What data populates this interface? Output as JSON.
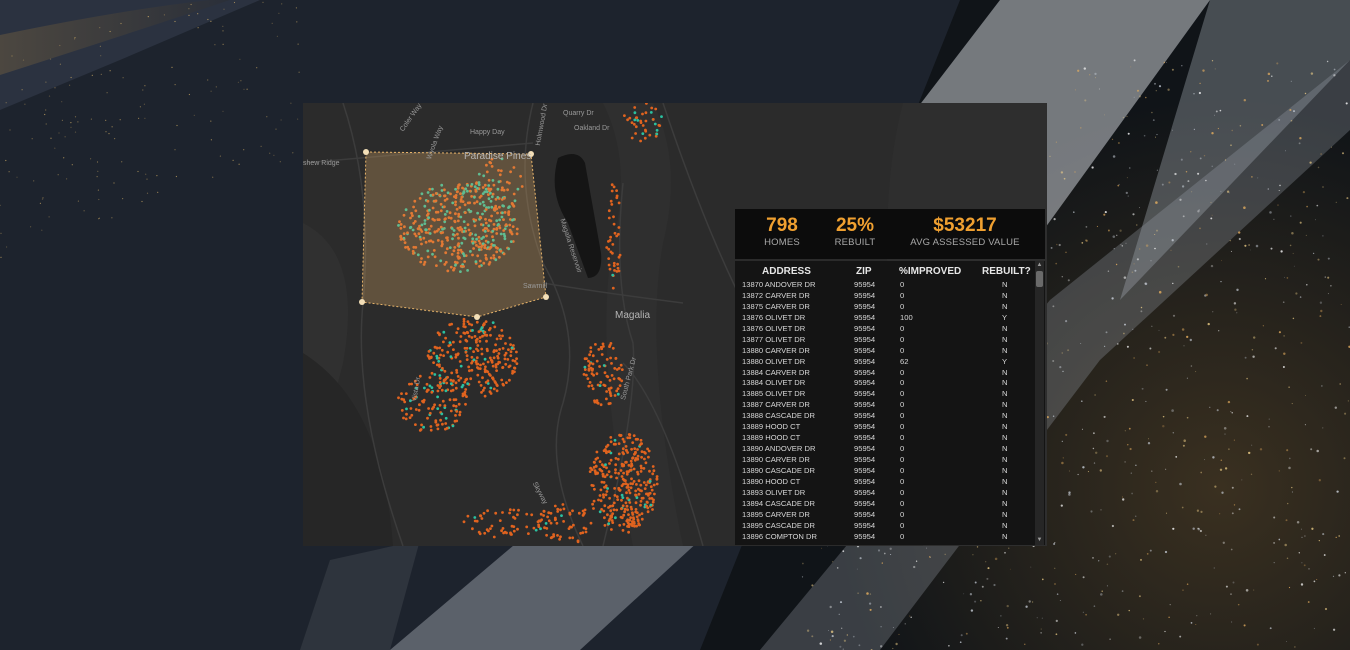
{
  "map": {
    "labels": {
      "quarry": "Quarry Dr",
      "oakland": "Oakland Dr",
      "happy_day": "Happy Day",
      "paradise_pines": "Paradise Pines",
      "ridge": "shew Ridge",
      "magalia": "Magalia",
      "reservoir": "Magalia Reservoir",
      "wyola": "Wyola Way",
      "coler": "Coler Way",
      "holmwood": "Holmwood Dr",
      "vista": "Vista Dr",
      "skyway": "Skyway",
      "south_park": "South Park Dr",
      "sawmill": "Sawmill"
    },
    "colors": {
      "not_rebuilt": "#e0631f",
      "rebuilt": "#2bc0a0",
      "selection": "#e8b46a"
    }
  },
  "stats": {
    "homes_value": "798",
    "homes_label": "HOMES",
    "rebuilt_value": "25%",
    "rebuilt_label": "REBUILT",
    "assessed_value": "$53217",
    "assessed_label": "AVG ASSESSED VALUE"
  },
  "table": {
    "headers": {
      "address": "ADDRESS",
      "zip": "ZIP",
      "improved": "%IMPROVED",
      "rebuilt": "REBUILT?"
    },
    "rows": [
      [
        "13870 ANDOVER DR",
        "95954",
        "0",
        "N"
      ],
      [
        "13872 CARVER DR",
        "95954",
        "0",
        "N"
      ],
      [
        "13875 CARVER DR",
        "95954",
        "0",
        "N"
      ],
      [
        "13876 OLIVET DR",
        "95954",
        "100",
        "Y"
      ],
      [
        "13876 OLIVET DR",
        "95954",
        "0",
        "N"
      ],
      [
        "13877 OLIVET DR",
        "95954",
        "0",
        "N"
      ],
      [
        "13880 CARVER DR",
        "95954",
        "0",
        "N"
      ],
      [
        "13880 OLIVET DR",
        "95954",
        "62",
        "Y"
      ],
      [
        "13884 CARVER DR",
        "95954",
        "0",
        "N"
      ],
      [
        "13884 OLIVET DR",
        "95954",
        "0",
        "N"
      ],
      [
        "13885 OLIVET DR",
        "95954",
        "0",
        "N"
      ],
      [
        "13887 CARVER DR",
        "95954",
        "0",
        "N"
      ],
      [
        "13888 CASCADE DR",
        "95954",
        "0",
        "N"
      ],
      [
        "13889 HOOD CT",
        "95954",
        "0",
        "N"
      ],
      [
        "13889 HOOD CT",
        "95954",
        "0",
        "N"
      ],
      [
        "13890 ANDOVER DR",
        "95954",
        "0",
        "N"
      ],
      [
        "13890 CARVER DR",
        "95954",
        "0",
        "N"
      ],
      [
        "13890 CASCADE DR",
        "95954",
        "0",
        "N"
      ],
      [
        "13890 HOOD CT",
        "95954",
        "0",
        "N"
      ],
      [
        "13893 OLIVET DR",
        "95954",
        "0",
        "N"
      ],
      [
        "13894 CASCADE DR",
        "95954",
        "0",
        "N"
      ],
      [
        "13895 CARVER DR",
        "95954",
        "0",
        "N"
      ],
      [
        "13895 CASCADE DR",
        "95954",
        "0",
        "N"
      ],
      [
        "13896 COMPTON DR",
        "95954",
        "0",
        "N"
      ]
    ]
  }
}
